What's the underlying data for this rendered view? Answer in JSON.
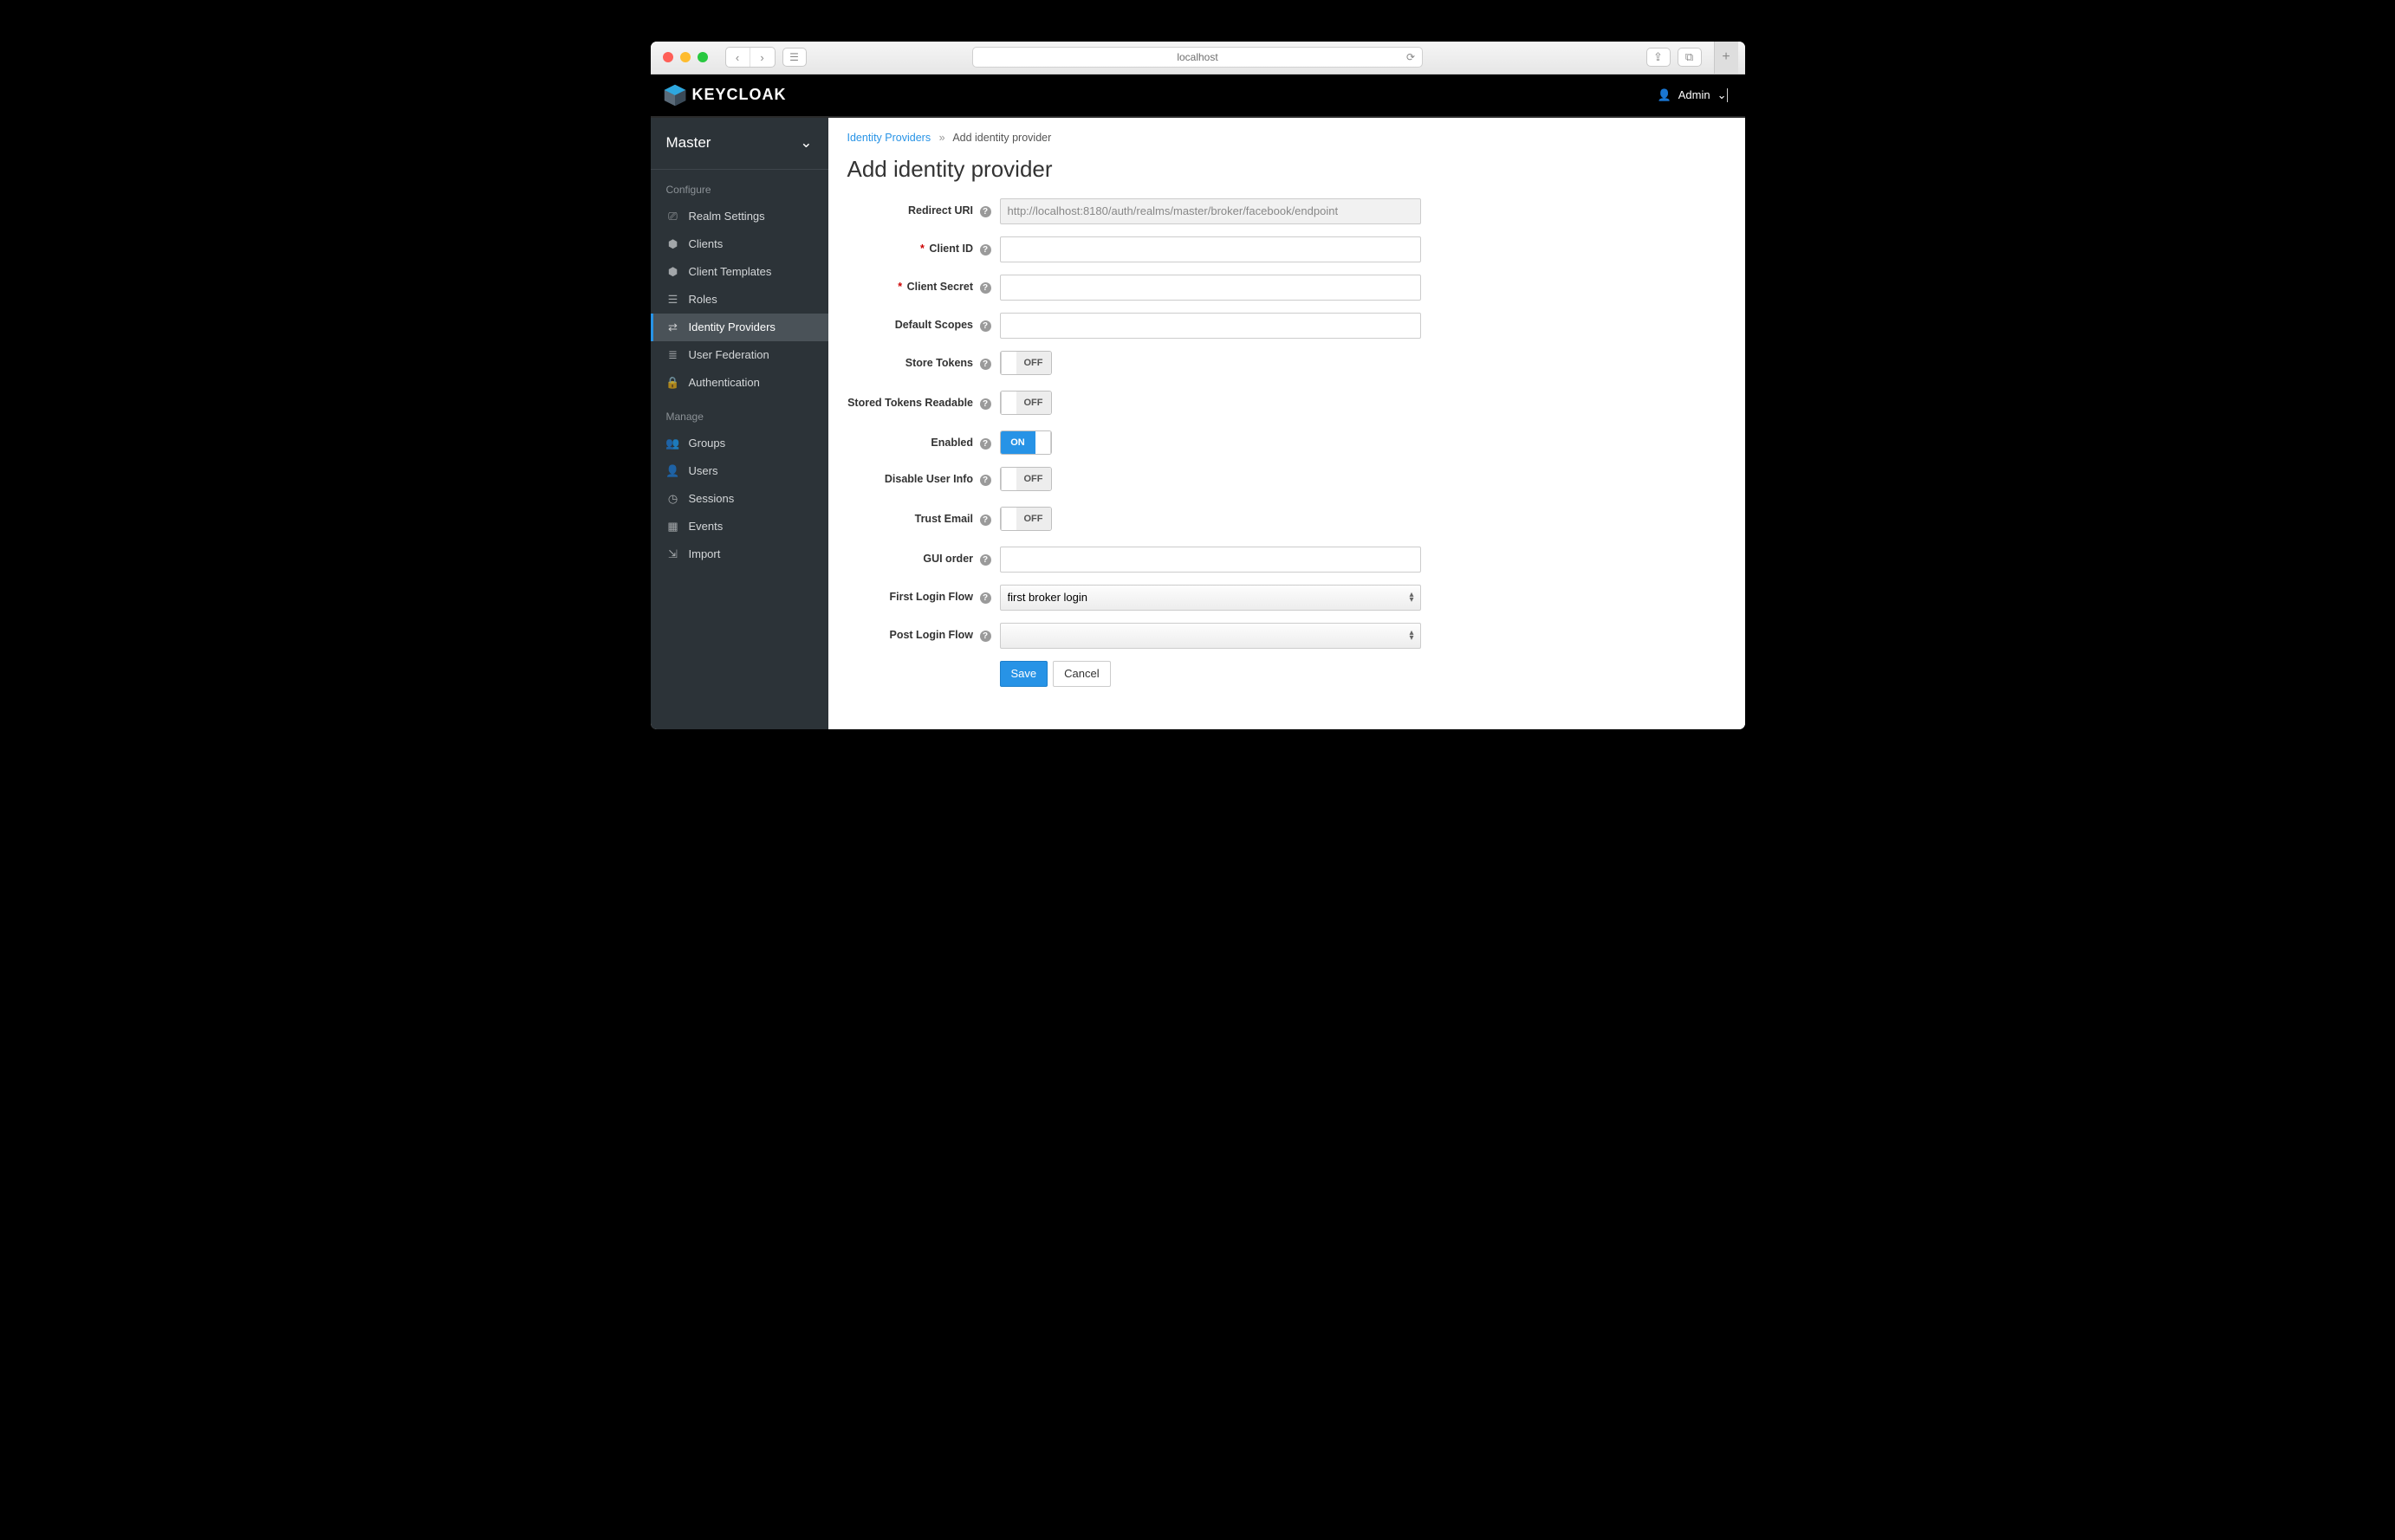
{
  "browser": {
    "url": "localhost"
  },
  "header": {
    "app_name": "KEYCLOAK",
    "user": "Admin"
  },
  "realm": {
    "name": "Master"
  },
  "sidebar": {
    "configure_title": "Configure",
    "manage_title": "Manage",
    "configure": [
      {
        "label": "Realm Settings",
        "icon": "sliders"
      },
      {
        "label": "Clients",
        "icon": "cube"
      },
      {
        "label": "Client Templates",
        "icon": "cubes"
      },
      {
        "label": "Roles",
        "icon": "list"
      },
      {
        "label": "Identity Providers",
        "icon": "exchange",
        "active": true
      },
      {
        "label": "User Federation",
        "icon": "database"
      },
      {
        "label": "Authentication",
        "icon": "lock"
      }
    ],
    "manage": [
      {
        "label": "Groups",
        "icon": "group"
      },
      {
        "label": "Users",
        "icon": "user"
      },
      {
        "label": "Sessions",
        "icon": "clock"
      },
      {
        "label": "Events",
        "icon": "calendar"
      },
      {
        "label": "Import",
        "icon": "import"
      }
    ]
  },
  "breadcrumb": {
    "parent": "Identity Providers",
    "current": "Add identity provider"
  },
  "page": {
    "title": "Add identity provider"
  },
  "form": {
    "redirect_uri": {
      "label": "Redirect URI",
      "value": "http://localhost:8180/auth/realms/master/broker/facebook/endpoint"
    },
    "client_id": {
      "label": "Client ID",
      "required": true,
      "value": ""
    },
    "client_secret": {
      "label": "Client Secret",
      "required": true,
      "value": ""
    },
    "default_scopes": {
      "label": "Default Scopes",
      "value": ""
    },
    "store_tokens": {
      "label": "Store Tokens",
      "value": "OFF"
    },
    "stored_tokens_readable": {
      "label": "Stored Tokens Readable",
      "value": "OFF"
    },
    "enabled": {
      "label": "Enabled",
      "value": "ON"
    },
    "disable_user_info": {
      "label": "Disable User Info",
      "value": "OFF"
    },
    "trust_email": {
      "label": "Trust Email",
      "value": "OFF"
    },
    "gui_order": {
      "label": "GUI order",
      "value": ""
    },
    "first_login_flow": {
      "label": "First Login Flow",
      "value": "first broker login"
    },
    "post_login_flow": {
      "label": "Post Login Flow",
      "value": ""
    }
  },
  "actions": {
    "save": "Save",
    "cancel": "Cancel"
  },
  "toggle_labels": {
    "on": "ON",
    "off": "OFF"
  }
}
